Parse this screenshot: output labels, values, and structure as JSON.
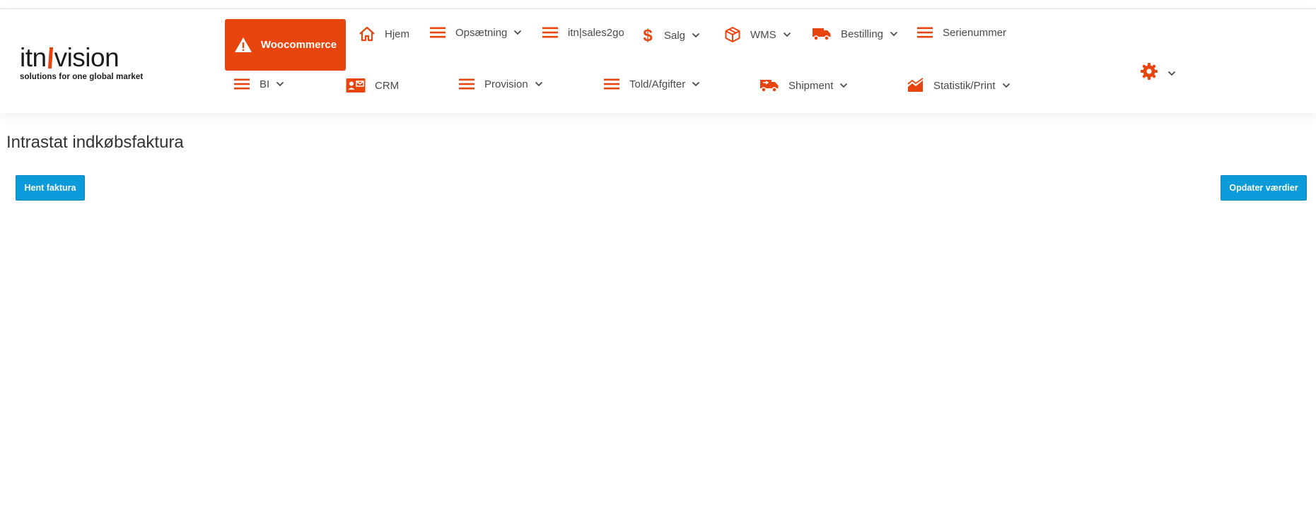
{
  "logo": {
    "part1": "itn",
    "part2": "vision",
    "tagline": "solutions for one global market"
  },
  "nav": {
    "woocommerce": "Woocommerce",
    "row1": [
      {
        "label": "Hjem",
        "icon": "home-icon",
        "dropdown": false
      },
      {
        "label": "Opsætning",
        "icon": "menu-lines-icon",
        "dropdown": true
      },
      {
        "label": "itn|sales2go",
        "icon": "menu-lines-icon",
        "dropdown": false
      },
      {
        "label": "Salg",
        "icon": "dollar-icon",
        "dropdown": true
      },
      {
        "label": "WMS",
        "icon": "box-icon",
        "dropdown": true
      },
      {
        "label": "Bestilling",
        "icon": "truck-icon",
        "dropdown": true
      },
      {
        "label": "Serienummer",
        "icon": "menu-lines-icon",
        "dropdown": false
      }
    ],
    "row2": [
      {
        "label": "BI",
        "icon": "menu-lines-icon",
        "dropdown": true
      },
      {
        "label": "CRM",
        "icon": "contact-card-icon",
        "dropdown": false
      },
      {
        "label": "Provision",
        "icon": "menu-lines-icon",
        "dropdown": true
      },
      {
        "label": "Told/Afgifter",
        "icon": "menu-lines-icon",
        "dropdown": true
      },
      {
        "label": "Shipment",
        "icon": "shipping-truck-icon",
        "dropdown": true
      },
      {
        "label": "Statistik/Print",
        "icon": "area-chart-icon",
        "dropdown": true
      }
    ]
  },
  "page": {
    "title": "Intrastat indkøbsfaktura",
    "buttons": {
      "fetch_invoice": "Hent faktura",
      "update_values": "Opdater værdier"
    }
  },
  "colors": {
    "accent": "#e8440d",
    "button": "#0b9bdb",
    "text": "#4a4a4a"
  }
}
